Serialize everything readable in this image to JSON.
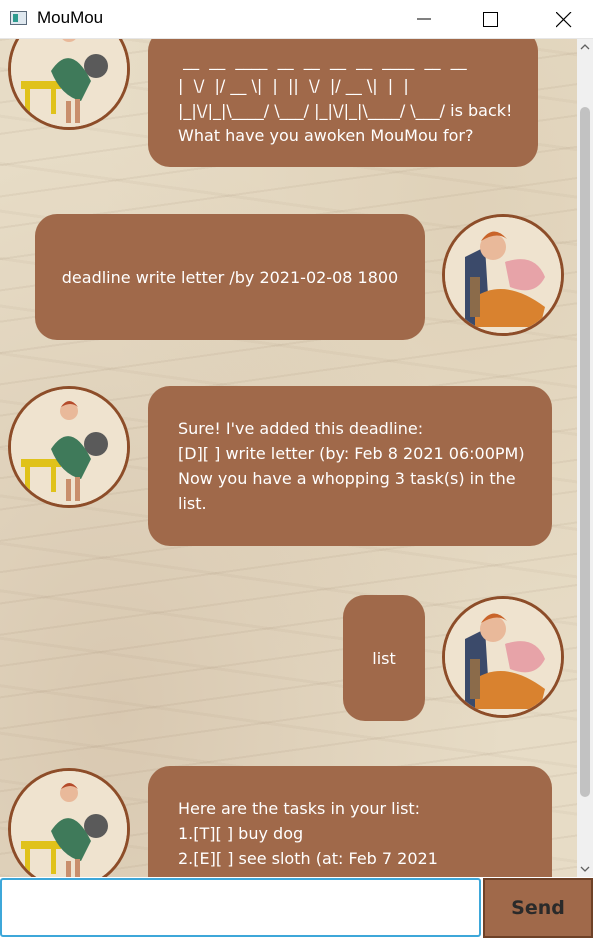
{
  "window": {
    "title": "MouMou"
  },
  "conversation": {
    "greeting_bot": {
      "ascii_lines": [
        " __  __  ____  __  __  __  __  ____  __  __",
        "|  \\/  |/ __ \\|  |  ||  \\/  |/ __ \\|  |  |",
        "|_|\\/|_|\\____/ \\___/ |_|\\/|_|\\____/ \\___/ is back!"
      ],
      "text": "What have you awoken MouMou for?"
    },
    "user_1": {
      "text": "deadline write letter /by 2021-02-08 1800"
    },
    "bot_1": {
      "lines": [
        "Sure! I've added this deadline:",
        "[D][ ] write letter (by: Feb 8 2021 06:00PM)",
        "Now you have a whopping 3 task(s) in the",
        "list."
      ]
    },
    "user_2": {
      "text": "list"
    },
    "bot_2": {
      "lines": [
        "Here are the tasks in your list:",
        "1.[T][ ] buy dog",
        "2.[E][ ] see sloth (at: Feb 7 2021"
      ]
    }
  },
  "input": {
    "value": "",
    "placeholder": ""
  },
  "send_button": {
    "label": "Send"
  },
  "colors": {
    "bubble": "#a0694a",
    "avatar_border": "#8d4d29",
    "input_focus": "#3da7d9",
    "background": "#e7dcc6"
  },
  "icons": {
    "app": "app-window-icon",
    "bot_avatar": "pinup-girl-avatar",
    "user_avatar": "sleeping-woman-avatar"
  }
}
